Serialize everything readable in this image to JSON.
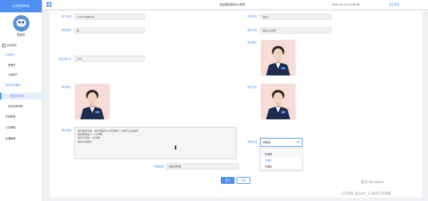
{
  "sidebar": {
    "brand": "后台管理系统",
    "user_name": "管理员",
    "menu": [
      {
        "label": "后台首页"
      },
      {
        "label": "系统用户"
      },
      {
        "label": "管理员"
      },
      {
        "label": "注册用户"
      },
      {
        "label": "报名信息管理"
      },
      {
        "label": "报名信息列表"
      },
      {
        "label": "报名信息审核"
      },
      {
        "label": "系统管理"
      },
      {
        "label": "公告管理"
      },
      {
        "label": "轮播管理"
      }
    ]
  },
  "header": {
    "title": "欢迎使用报名小程序",
    "datetime": "2024-05-14 10:33:26",
    "logout": "退出登录"
  },
  "form": {
    "phone_label": "用户电话",
    "phone_value": "13813888888",
    "name_label": "报名姓名",
    "name_value": "测试1",
    "gender_label": "报名性别",
    "gender_value": "男",
    "school_label": "报名学校",
    "school_value": "重庆XX学院",
    "photo1_label": "报名照片",
    "idno_label": "报名身份证",
    "idno_value": "220",
    "photo2_label": "报名照片",
    "photo3_label": "报名证件",
    "photo4_label": "报名照片",
    "remark_label": "报名说明",
    "remark_lines": [
      "我们报名学校：我们是重庆XX学院院长 / 请你们认真填写",
      "我也是报名人：XX学院",
      "我们不过的：XX学院",
      "请你认真填写"
    ],
    "status_label": "审核状态",
    "status_value": "待审核",
    "status_options": [
      "未审核",
      "已通过",
      "未通过"
    ],
    "reply_label": "审核回复",
    "reply_value": "请填写审核"
  },
  "buttons": {
    "submit": "提交",
    "back": "返回"
  },
  "watermark": {
    "activate": "激活 Windows",
    "csdn": "CSDN @vx2_CxKf10088"
  }
}
